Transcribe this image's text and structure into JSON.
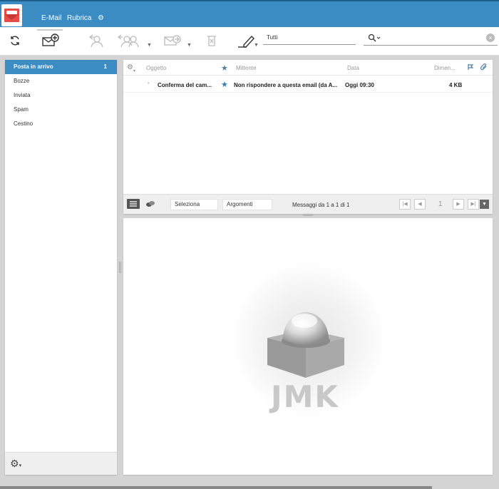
{
  "header": {
    "nav_email": "E-Mail",
    "nav_rubrica": "Rubrica",
    "accent_color": "#3a8cc3"
  },
  "toolbar": {
    "filter_value": "Tutti",
    "search_placeholder": "",
    "icons": [
      "refresh-icon",
      "compose-icon",
      "reply-icon",
      "reply-all-icon",
      "forward-icon",
      "delete-icon",
      "mark-icon",
      "search-icon"
    ]
  },
  "folders": {
    "items": [
      {
        "label": "Posta in arrivo",
        "count": "1"
      },
      {
        "label": "Bozze"
      },
      {
        "label": "Inviata"
      },
      {
        "label": "Spam"
      },
      {
        "label": "Cestino"
      }
    ]
  },
  "messages": {
    "columns": {
      "subject": "Oggetto",
      "from": "Mittente",
      "date": "Data",
      "size": "Dimen..."
    },
    "rows": [
      {
        "subject": "Conferma del cam...",
        "from": "Non rispondere a questa email (da A...",
        "date": "Oggi 09:30",
        "size": "4 KB"
      }
    ],
    "pager": {
      "select_label": "Seleziona",
      "threads_label": "Argomenti",
      "info": "Messaggi da 1 a 1 di 1",
      "page": "1"
    }
  },
  "preview": {
    "logo_text": "JMK"
  }
}
